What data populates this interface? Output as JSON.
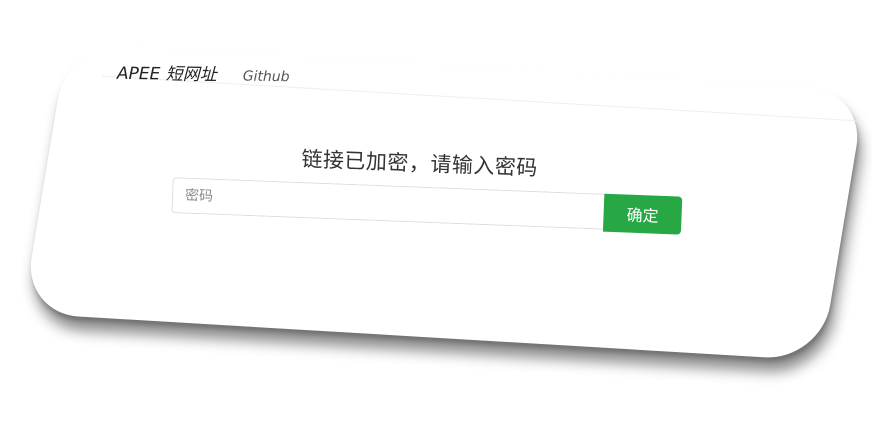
{
  "navbar": {
    "brand": "APEE 短网址",
    "links": [
      {
        "label": "Github"
      }
    ]
  },
  "main": {
    "title": "链接已加密，请输入密码",
    "password_input": {
      "placeholder": "密码",
      "value": ""
    },
    "confirm_button": "确定"
  },
  "colors": {
    "confirm_button_bg": "#28a745",
    "confirm_button_text": "#ffffff",
    "page_bg": "#ffffff"
  }
}
